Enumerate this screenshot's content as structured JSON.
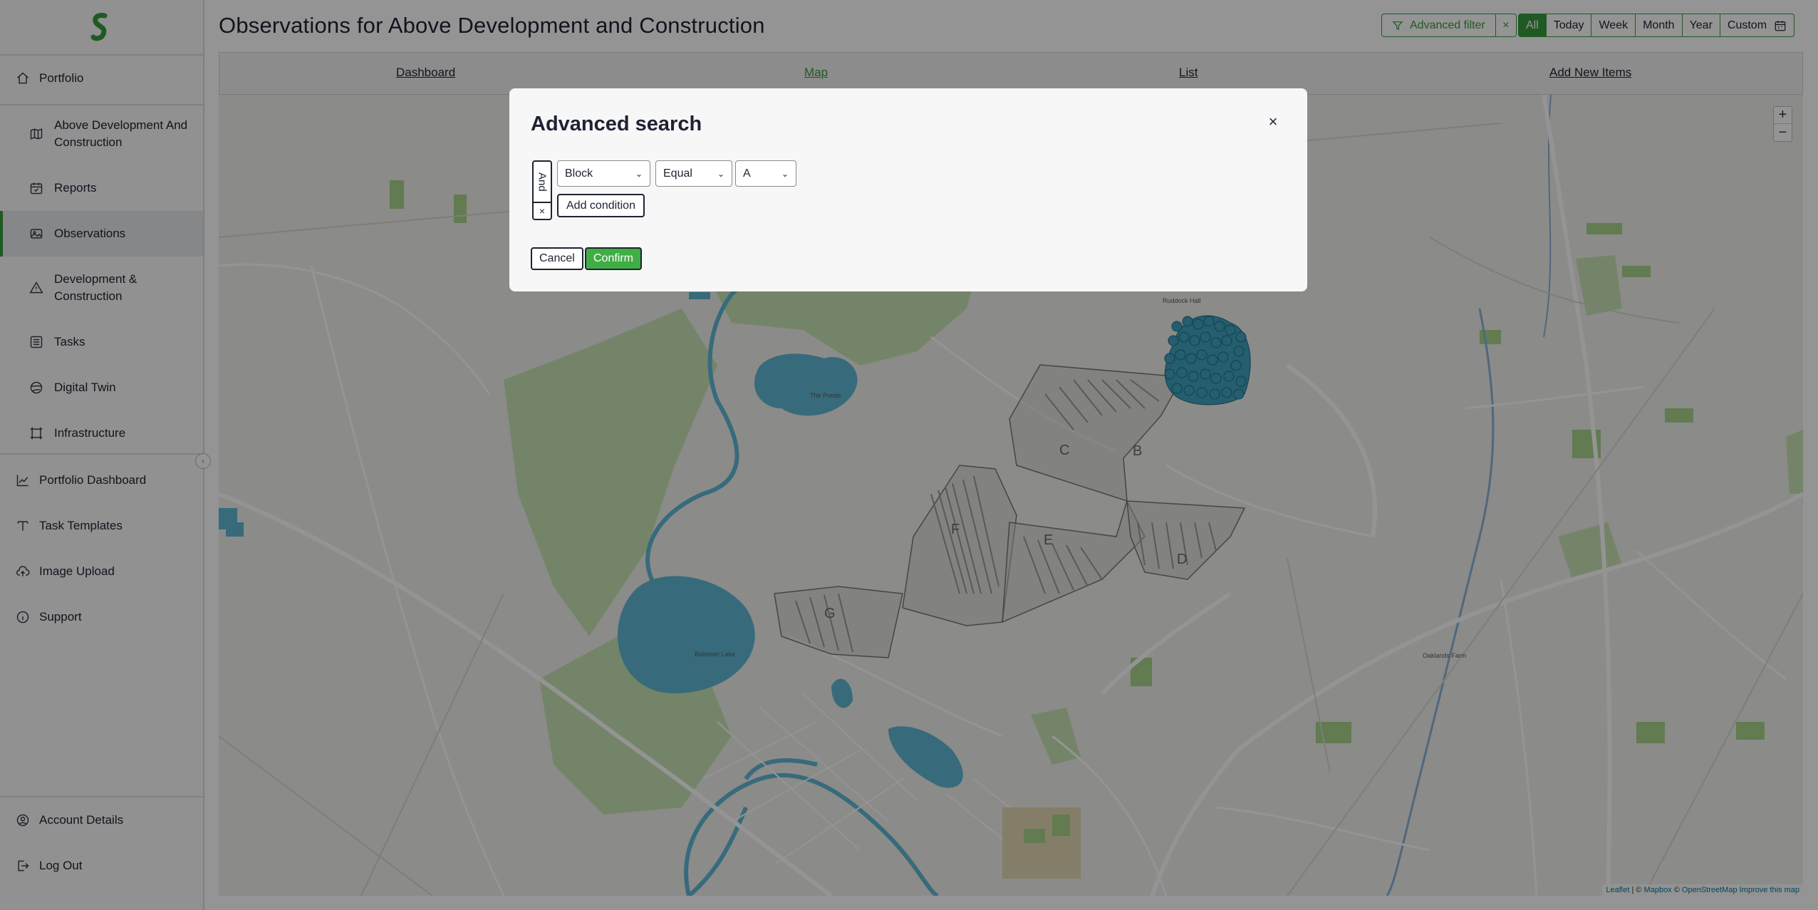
{
  "page": {
    "title": "Observations for Above Development and Construction"
  },
  "sidebar": {
    "top_items": [
      {
        "label": "Portfolio",
        "icon": "home-icon"
      }
    ],
    "sub_items": [
      {
        "label": "Above Development And Construction",
        "icon": "map-icon"
      },
      {
        "label": "Reports",
        "icon": "calendar-check-icon"
      },
      {
        "label": "Observations",
        "icon": "image-icon",
        "active": true
      },
      {
        "label": "Development & Construction",
        "icon": "triangle-alert-icon"
      },
      {
        "label": "Tasks",
        "icon": "list-icon"
      },
      {
        "label": "Digital Twin",
        "icon": "globe-icon"
      },
      {
        "label": "Infrastructure",
        "icon": "frame-icon"
      }
    ],
    "lower_items": [
      {
        "label": "Portfolio Dashboard",
        "icon": "chart-line-icon"
      },
      {
        "label": "Task Templates",
        "icon": "text-t-icon"
      },
      {
        "label": "Image Upload",
        "icon": "cloud-upload-icon"
      },
      {
        "label": "Support",
        "icon": "info-icon"
      }
    ],
    "bottom_items": [
      {
        "label": "Account Details",
        "icon": "user-circle-icon"
      },
      {
        "label": "Log Out",
        "icon": "logout-icon"
      }
    ]
  },
  "header": {
    "advanced_filter_label": "Advanced filter",
    "clear_filter_label": "×",
    "ranges": [
      "All",
      "Today",
      "Week",
      "Month",
      "Year",
      "Custom"
    ],
    "active_range": "All"
  },
  "tabs": [
    {
      "label": "Dashboard"
    },
    {
      "label": "Map",
      "active": true
    },
    {
      "label": "List"
    },
    {
      "label": "Add New Items"
    }
  ],
  "map": {
    "zoom_in": "+",
    "zoom_out": "−",
    "attribution": {
      "leaflet": "Leaflet",
      "sep": " | © ",
      "mapbox": "Mapbox",
      "sep2": " © ",
      "osm": "OpenStreetMap",
      "improve": "Improve this map"
    },
    "blocks": [
      "B",
      "C",
      "D",
      "E",
      "F",
      "G"
    ],
    "places": [
      "Bolsover Lake",
      "The Ponds",
      "Ruddock Hall",
      "Oaklands Farm"
    ]
  },
  "modal": {
    "title": "Advanced search",
    "close": "×",
    "group_operator": "And",
    "group_remove": "×",
    "condition": {
      "field": "Block",
      "operator": "Equal",
      "value": "A"
    },
    "add_condition_label": "Add condition",
    "cancel_label": "Cancel",
    "confirm_label": "Confirm"
  },
  "colors": {
    "accent": "#3a9a3e",
    "confirm": "#3fae44",
    "water": "#5fb8d4",
    "park": "#c9e4b6"
  }
}
